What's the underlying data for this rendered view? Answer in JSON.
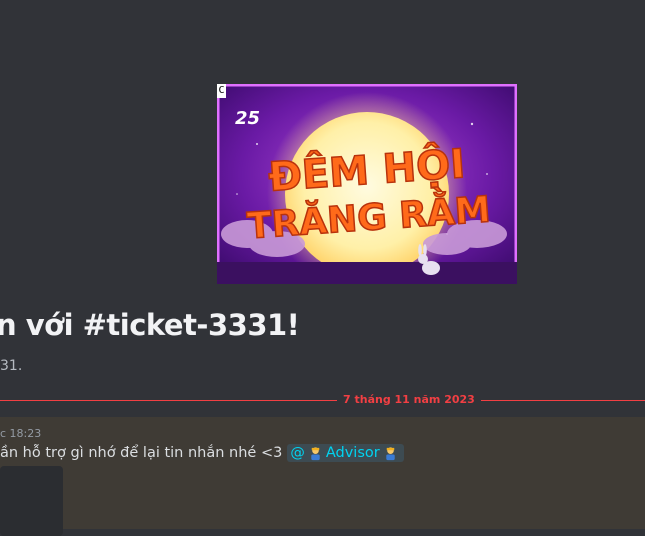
{
  "banner": {
    "corner_glyph": "C",
    "headline_line1": "ĐÊM HỘI",
    "headline_line2": "TRĂNG RẰM",
    "logo_text": "25"
  },
  "channel": {
    "welcome_title": "n với #ticket-3331!",
    "welcome_subtitle": "31."
  },
  "divider": {
    "date_label": "7 tháng 11 năm 2023"
  },
  "message": {
    "timestamp": "c 18:23",
    "text": "ần hỗ trợ gì nhớ để lại tin nhắn nhé <3",
    "mention_prefix": "@",
    "mention_role": "Advisor"
  },
  "colors": {
    "background": "#313338",
    "divider_red": "#f23f43",
    "mention_text": "#00d3f0",
    "highlight_bg": "#3f3b35"
  }
}
